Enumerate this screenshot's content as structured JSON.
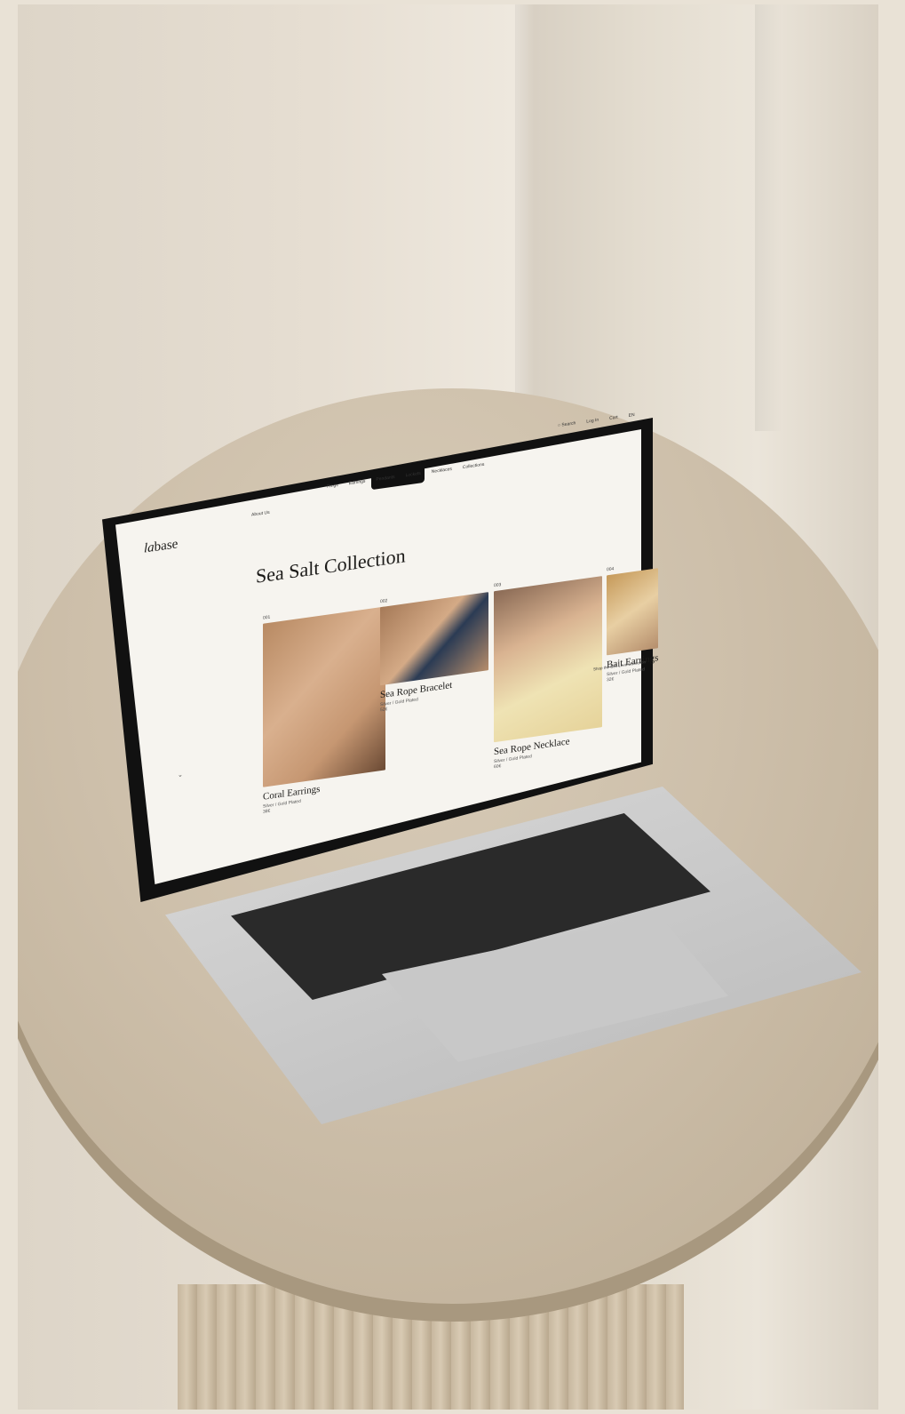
{
  "site": {
    "brand_italic": "la",
    "brand_rest": "base",
    "nav_about": "About Us",
    "nav": [
      "Rings",
      "Earrings",
      "Pendants",
      "Lockets",
      "Necklaces",
      "Collections"
    ],
    "util": {
      "search": "Search",
      "login": "Log In",
      "cart": "Cart",
      "lang": "EN"
    },
    "title": "Sea Salt Collection",
    "products": [
      {
        "num": "001",
        "name": "Coral Earrings",
        "sub": "Silver / Gold Plated",
        "price": "38€"
      },
      {
        "num": "002",
        "name": "Sea Rope Bracelet",
        "sub": "Silver / Gold Plated",
        "price": "52€"
      },
      {
        "num": "003",
        "name": "Sea Rope Necklace",
        "sub": "Silver / Gold Plated",
        "price": "60€"
      },
      {
        "num": "004",
        "name": "Bait Earrings",
        "sub": "Silver / Gold Plated",
        "price": "32€"
      }
    ],
    "show_all": "Shop the Self Love Collection",
    "chevron": "⌄"
  },
  "colors": {
    "screen_bg": "#f6f4ef",
    "text": "#1c1b19",
    "skin": "#c9966c",
    "table": "#cdbfaa"
  }
}
